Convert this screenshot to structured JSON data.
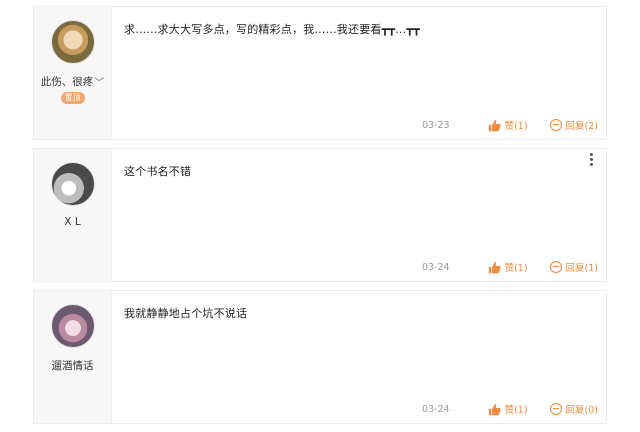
{
  "comments": [
    {
      "username": "此伤、很疼",
      "badge": "置顶",
      "content": "求……求大大写多点，写的精彩点，我……我还要看┳┳...┳┳",
      "date": "03-23",
      "like_label": "赞(1)",
      "reply_label": "回复(2)"
    },
    {
      "username": "X L",
      "content": "这个书名不错",
      "date": "03-24",
      "like_label": "赞(1)",
      "reply_label": "回复(1)"
    },
    {
      "username": "遛酒情话",
      "content": "我就静静地占个坑不说话",
      "date": "03-24",
      "like_label": "赞(1)",
      "reply_label": "回复(0)"
    }
  ],
  "colors": {
    "accent": "#f08a3c",
    "badge": "#f5a56d",
    "date": "#999999"
  },
  "icons": [
    "thumbs-up-icon",
    "reply-icon",
    "more-vertical-icon",
    "chevron-down-icon"
  ]
}
